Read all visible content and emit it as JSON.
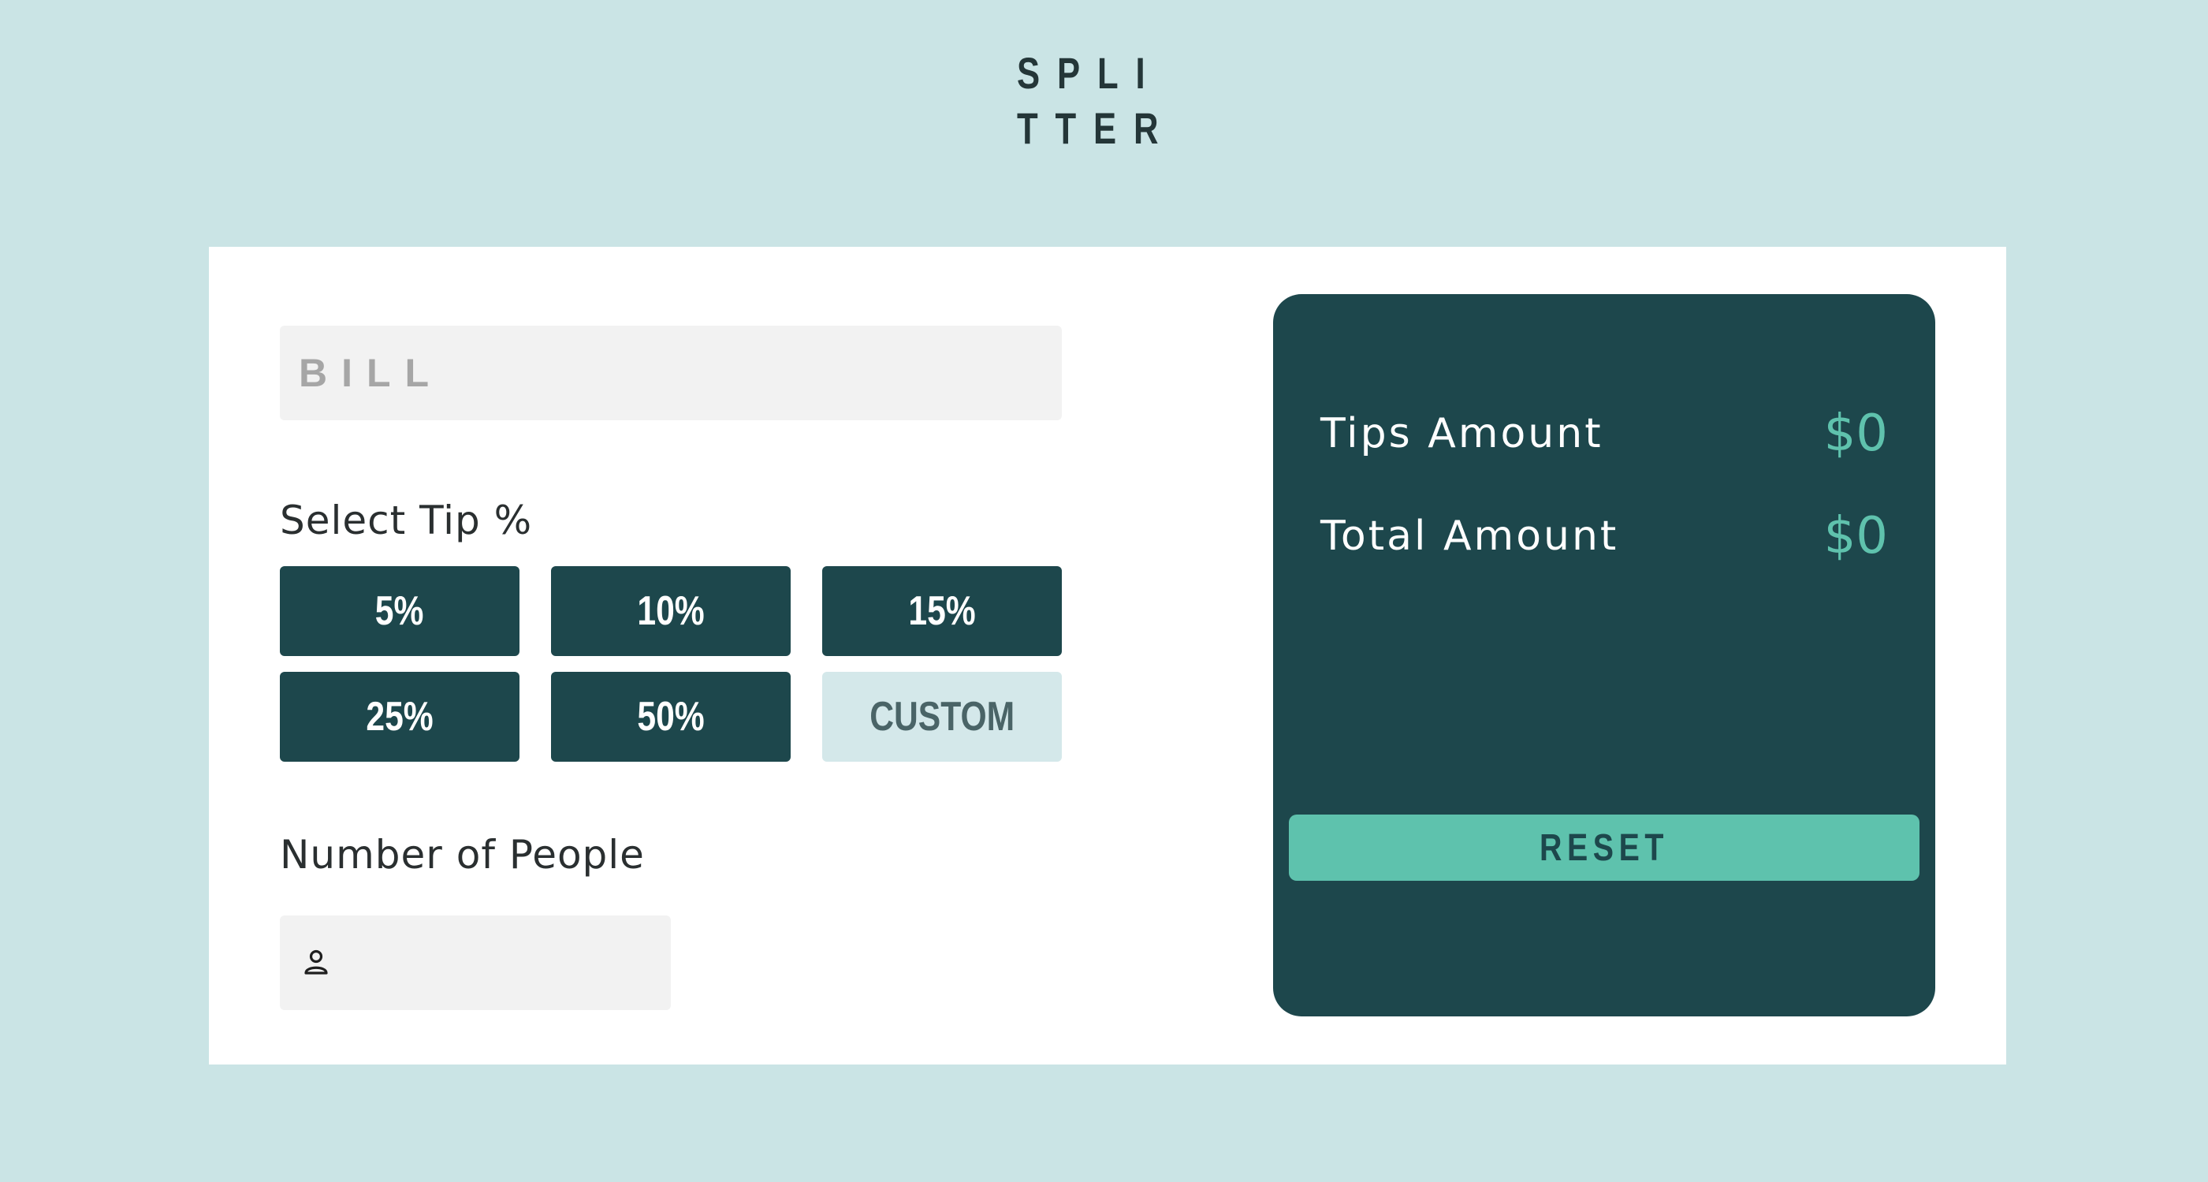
{
  "logo": {
    "line1": "SPLI",
    "line2": "TTER"
  },
  "bill": {
    "placeholder": "BILL",
    "value": ""
  },
  "tip": {
    "label": "Select Tip %",
    "options": [
      "5%",
      "10%",
      "15%",
      "25%",
      "50%"
    ],
    "custom_label": "CUSTOM"
  },
  "people": {
    "label": "Number of People",
    "icon": "person-icon",
    "value": ""
  },
  "results": {
    "tips_label": "Tips Amount",
    "tips_value": "$0",
    "total_label": "Total Amount",
    "total_value": "$0",
    "reset_label": "RESET"
  },
  "colors": {
    "background": "#cae4e5",
    "panel": "#1d474c",
    "accent": "#5ec2ad",
    "custom_button": "#d4e8ea"
  }
}
